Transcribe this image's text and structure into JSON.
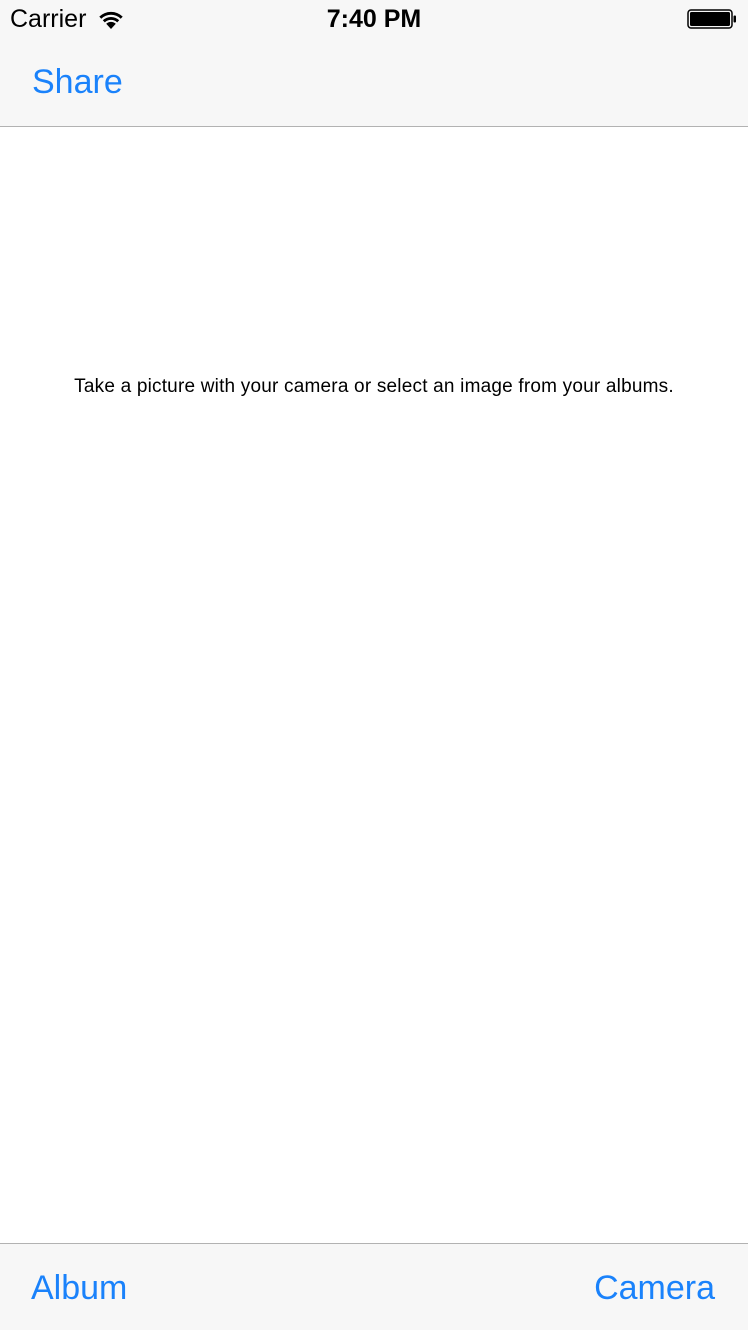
{
  "status_bar": {
    "carrier": "Carrier",
    "time": "7:40 PM",
    "wifi_icon": "wifi-icon",
    "battery_icon": "battery-icon"
  },
  "nav_bar": {
    "share_label": "Share"
  },
  "content": {
    "instruction": "Take a picture with your camera or select an image from your albums."
  },
  "toolbar": {
    "album_label": "Album",
    "camera_label": "Camera"
  },
  "colors": {
    "accent": "#1a82fb",
    "bar_background": "#f7f7f7",
    "separator": "#b2b2b2"
  }
}
